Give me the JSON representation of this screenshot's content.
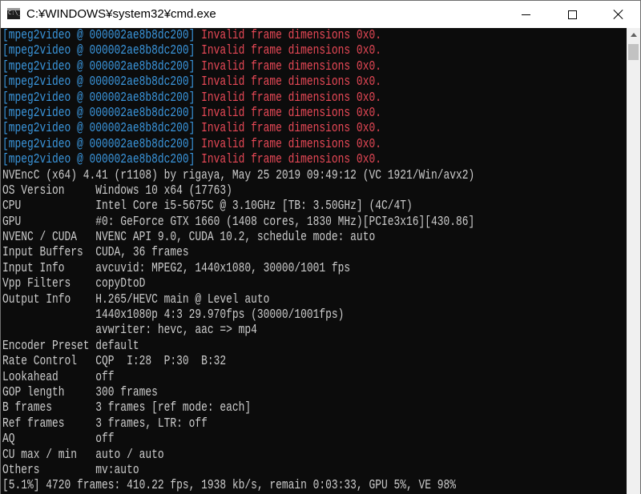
{
  "window": {
    "title": "C:¥WINDOWS¥system32¥cmd.exe"
  },
  "console": {
    "errors": [
      {
        "source": "[mpeg2video @ 000002ae8b8dc200] ",
        "message": "Invalid frame dimensions 0x0."
      },
      {
        "source": "[mpeg2video @ 000002ae8b8dc200] ",
        "message": "Invalid frame dimensions 0x0."
      },
      {
        "source": "[mpeg2video @ 000002ae8b8dc200] ",
        "message": "Invalid frame dimensions 0x0."
      },
      {
        "source": "[mpeg2video @ 000002ae8b8dc200] ",
        "message": "Invalid frame dimensions 0x0."
      },
      {
        "source": "[mpeg2video @ 000002ae8b8dc200] ",
        "message": "Invalid frame dimensions 0x0."
      },
      {
        "source": "[mpeg2video @ 000002ae8b8dc200] ",
        "message": "Invalid frame dimensions 0x0."
      },
      {
        "source": "[mpeg2video @ 000002ae8b8dc200] ",
        "message": "Invalid frame dimensions 0x0."
      },
      {
        "source": "[mpeg2video @ 000002ae8b8dc200] ",
        "message": "Invalid frame dimensions 0x0."
      },
      {
        "source": "[mpeg2video @ 000002ae8b8dc200] ",
        "message": "Invalid frame dimensions 0x0."
      }
    ],
    "lines": [
      "NVEncC (x64) 4.41 (r1108) by rigaya, May 25 2019 09:49:12 (VC 1921/Win/avx2)",
      "OS Version     Windows 10 x64 (17763)",
      "CPU            Intel Core i5-5675C @ 3.10GHz [TB: 3.50GHz] (4C/4T)",
      "GPU            #0: GeForce GTX 1660 (1408 cores, 1830 MHz)[PCIe3x16][430.86]",
      "NVENC / CUDA   NVENC API 9.0, CUDA 10.2, schedule mode: auto",
      "Input Buffers  CUDA, 36 frames",
      "Input Info     avcuvid: MPEG2, 1440x1080, 30000/1001 fps",
      "Vpp Filters    copyDtoD",
      "Output Info    H.265/HEVC main @ Level auto",
      "               1440x1080p 4:3 29.970fps (30000/1001fps)",
      "               avwriter: hevc, aac => mp4",
      "Encoder Preset default",
      "Rate Control   CQP  I:28  P:30  B:32",
      "Lookahead      off",
      "GOP length     300 frames",
      "B frames       3 frames [ref mode: each]",
      "Ref frames     3 frames, LTR: off",
      "AQ             off",
      "CU max / min   auto / auto",
      "Others         mv:auto",
      "[5.1%] 4720 frames: 410.22 fps, 1938 kb/s, remain 0:03:33, GPU 5%, VE 98%"
    ]
  },
  "colors": {
    "console_bg": "#0c0c0c",
    "console_text": "#cccccc",
    "error_source": "#3a96dd",
    "error_message": "#e74856"
  },
  "icons": {
    "app": "cmd-app-icon",
    "minimize": "minimize-icon",
    "maximize": "maximize-icon",
    "close": "close-icon"
  }
}
